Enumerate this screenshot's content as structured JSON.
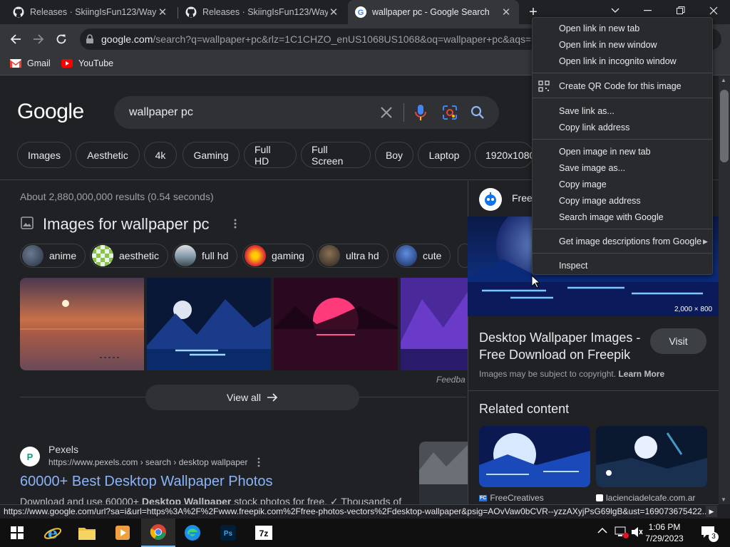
{
  "tabs": [
    {
      "title": "Releases · SkiingIsFun123/Wayba",
      "favicon": "github-icon"
    },
    {
      "title": "Releases · SkiingIsFun123/Wayba",
      "favicon": "github-icon"
    },
    {
      "title": "wallpaper pc - Google Search",
      "favicon": "google-icon",
      "active": true
    }
  ],
  "toolbar": {
    "url_host": "google.com",
    "url_rest": "/search?q=wallpaper+pc&rlz=1C1CHZO_enUS1068US1068&oq=wallpaper+pc&aqs=",
    "bookmarks": [
      "Gmail",
      "YouTube"
    ]
  },
  "search": {
    "logo": "Google",
    "query": "wallpaper pc",
    "filters": [
      "Images",
      "Aesthetic",
      "4k",
      "Gaming",
      "Full HD",
      "Full Screen",
      "Boy",
      "Laptop",
      "1920x1080"
    ],
    "stats": "About 2,880,000,000 results (0.54 seconds)"
  },
  "images_section": {
    "title": "Images for wallpaper pc",
    "chips": [
      "anime",
      "aesthetic",
      "full hd",
      "gaming",
      "ultra hd",
      "cute"
    ],
    "view_all": "View all",
    "feedback": "Feedba"
  },
  "result": {
    "favicon_letter": "P",
    "site": "Pexels",
    "cite": "https://www.pexels.com › search › desktop wallpaper",
    "title": "60000+ Best Desktop Wallpaper Photos",
    "snippet_a": "Download and use 60000+ ",
    "snippet_b": "Desktop Wallpaper",
    "snippet_c": " stock photos for free. ✓ Thousands of"
  },
  "side_panel": {
    "source": "Free",
    "dimensions": "2,000 × 800",
    "title": "Desktop Wallpaper Images - Free Download on Freepik",
    "visit": "Visit",
    "copyright_a": "Images may be subject to copyright.",
    "copyright_b": "Learn More",
    "related_title": "Related content",
    "related": [
      {
        "source": "FreeCreatives",
        "badge": "FC"
      },
      {
        "source": "lacienciadelcafe.com.ar"
      }
    ]
  },
  "context_menu": {
    "items": [
      "Open link in new tab",
      "Open link in new window",
      "Open link in incognito window",
      "Create QR Code for this image",
      "Save link as...",
      "Copy link address",
      "Open image in new tab",
      "Save image as...",
      "Copy image",
      "Copy image address",
      "Search image with Google",
      "Get image descriptions from Google",
      "Inspect"
    ]
  },
  "status_bar": "https://www.google.com/url?sa=i&url=https%3A%2F%2Fwww.freepik.com%2Ffree-photos-vectors%2Fdesktop-wallpaper&psig=AOvVaw0bCVR--yzzAXyjPsG69lgB&ust=169073675422...",
  "taskbar": {
    "time": "1:06 PM",
    "date": "7/29/2023",
    "notification_count": "3"
  },
  "colors": {
    "background": "#202124",
    "link": "#8ab4f8",
    "accent_blue": "#8ab4f8",
    "menu_bg": "#292a2d"
  }
}
